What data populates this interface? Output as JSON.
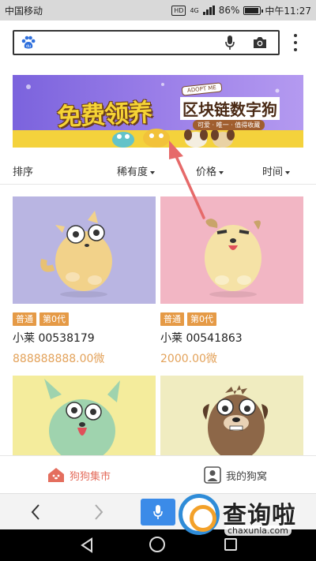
{
  "status_bar": {
    "carrier": "中国移动",
    "hd": "HD",
    "network": "4G",
    "battery": "86%",
    "battery_level": 0.86,
    "time": "中午11:27"
  },
  "search": {
    "placeholder": "",
    "logo": "du-paw-icon"
  },
  "banner": {
    "title": "免费领养",
    "subtitle": "区块链数字狗",
    "tag": "ADOPT ME",
    "tagline": "可爱 · 唯一 · 值得收藏"
  },
  "sort": {
    "label": "排序",
    "options": [
      "稀有度",
      "价格",
      "时间"
    ]
  },
  "dogs": [
    {
      "tags": [
        "普通",
        "第0代"
      ],
      "name": "小莱 00538179",
      "price": "888888888.00微",
      "bg": "#b9b5e2",
      "body": "#f2d28a"
    },
    {
      "tags": [
        "普通",
        "第0代"
      ],
      "name": "小莱 00541863",
      "price": "2000.00微",
      "bg": "#f2b6c4",
      "body": "#f5e2a6"
    },
    {
      "tags": [],
      "name": "",
      "price": "",
      "bg": "#f4ec9c",
      "body": "#9fd3ae"
    },
    {
      "tags": [],
      "name": "",
      "price": "",
      "bg": "#f0ecc0",
      "body": "#8d6748"
    }
  ],
  "tabs": {
    "market": "狗狗集市",
    "mine": "我的狗窝"
  },
  "colors": {
    "accent_orange": "#e59a46",
    "price": "#e3a25a",
    "tab_active": "#e46e5e",
    "voice": "#3b8be8"
  },
  "watermark": {
    "text": "查询啦",
    "url": "chaxunla.com"
  }
}
